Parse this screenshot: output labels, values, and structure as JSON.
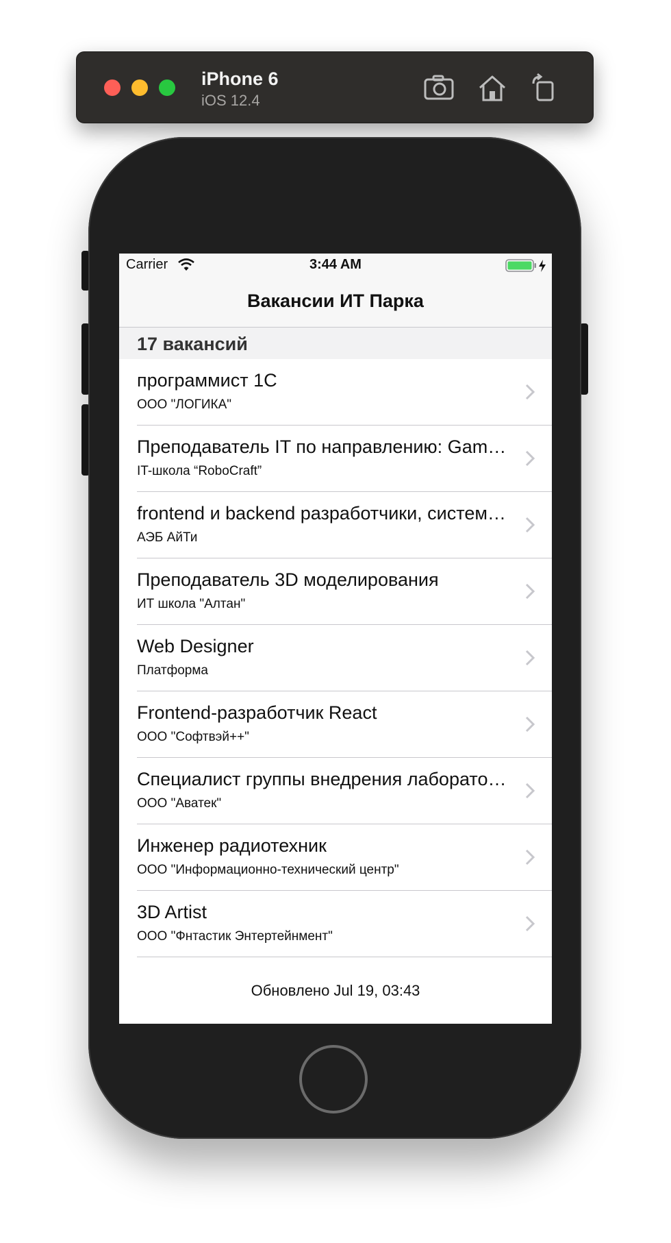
{
  "simulator": {
    "device_name": "iPhone 6",
    "os_version": "iOS 12.4",
    "toolbar_icons": [
      "screenshot-icon",
      "home-icon",
      "rotate-icon"
    ]
  },
  "status_bar": {
    "carrier": "Carrier",
    "time": "3:44 AM",
    "battery_color": "#4cd964"
  },
  "nav": {
    "title": "Вакансии ИТ Парка"
  },
  "section": {
    "header": "17 вакансий"
  },
  "vacancies": [
    {
      "title": "программист 1С",
      "company": "ООО \"ЛОГИКА\""
    },
    {
      "title": "Преподаватель IT по направлению: Game Design",
      "company": "IT-школа “RoboCraft”"
    },
    {
      "title": "frontend и backend разработчики, системный администратор",
      "company": "АЭБ АйТи"
    },
    {
      "title": "Преподаватель 3D моделирования",
      "company": "ИТ школа \"Алтан\""
    },
    {
      "title": "Web Designer",
      "company": "Платформа"
    },
    {
      "title": "Frontend-разработчик React",
      "company": "ООО \"Софтвэй++\""
    },
    {
      "title": "Специалист группы внедрения лабораторных систем",
      "company": "ООО \"Аватек\""
    },
    {
      "title": "Инженер радиотехник",
      "company": "ООО \"Информационно-технический центр\""
    },
    {
      "title": "3D Artist",
      "company": "ООО \"Фнтастик Энтертейнмент\""
    }
  ],
  "footer": {
    "updated": "Обновлено Jul 19, 03:43"
  }
}
